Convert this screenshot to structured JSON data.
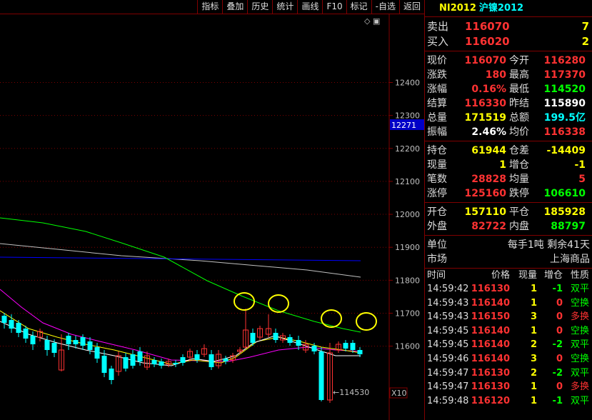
{
  "toolbar": {
    "items": [
      "指标",
      "叠加",
      "历史",
      "统计",
      "画线",
      "F10",
      "标记",
      "-自选",
      "返回"
    ]
  },
  "chart": {
    "price_labels": [
      "12400",
      "12300",
      "12271",
      "12200",
      "12100",
      "12000",
      "11900",
      "11800",
      "11700",
      "11600"
    ],
    "low_marker": "←114530",
    "zoom_label": "X10",
    "corner_symbols": "◇ ▣",
    "colors": {
      "up": "#ff3232",
      "down": "#00ffff",
      "ma5": "#ffffff",
      "ma10": "#ffff00",
      "ma20": "#ff00ff",
      "ma60": "#00ff00",
      "ma120": "#0000ff",
      "ma250": "#c0c0c0",
      "highlight": "#ffff00"
    }
  },
  "panel": {
    "code": "NI2012",
    "name": "沪镍2012",
    "orderbook": [
      {
        "label": "卖出",
        "price": "116070",
        "volume": "7"
      },
      {
        "label": "买入",
        "price": "116020",
        "volume": "2"
      }
    ],
    "quote1": [
      {
        "l1": "现价",
        "v1": "116070",
        "c1": "red",
        "l2": "今开",
        "v2": "116280",
        "c2": "red"
      },
      {
        "l1": "涨跌",
        "v1": "180",
        "c1": "red",
        "l2": "最高",
        "v2": "117370",
        "c2": "red"
      },
      {
        "l1": "涨幅",
        "v1": "0.16%",
        "c1": "red",
        "l2": "最低",
        "v2": "114520",
        "c2": "green"
      },
      {
        "l1": "结算",
        "v1": "116330",
        "c1": "red",
        "l2": "昨结",
        "v2": "115890",
        "c2": "white"
      },
      {
        "l1": "总量",
        "v1": "171519",
        "c1": "yellow",
        "l2": "总额",
        "v2": "199.5亿",
        "c2": "cyan"
      },
      {
        "l1": "振幅",
        "v1": "2.46%",
        "c1": "white",
        "l2": "均价",
        "v2": "116338",
        "c2": "red"
      }
    ],
    "quote2": [
      {
        "l1": "持仓",
        "v1": "61944",
        "c1": "yellow",
        "l2": "仓差",
        "v2": "-14409",
        "c2": "yellow"
      },
      {
        "l1": "现量",
        "v1": "1",
        "c1": "yellow",
        "l2": "增仓",
        "v2": "-1",
        "c2": "yellow"
      },
      {
        "l1": "笔数",
        "v1": "28828",
        "c1": "red",
        "l2": "均量",
        "v2": "5",
        "c2": "red"
      },
      {
        "l1": "涨停",
        "v1": "125160",
        "c1": "red",
        "l2": "跌停",
        "v2": "106610",
        "c2": "green"
      }
    ],
    "quote3": [
      {
        "l1": "开仓",
        "v1": "157110",
        "c1": "yellow",
        "l2": "平仓",
        "v2": "185928",
        "c2": "yellow"
      },
      {
        "l1": "外盘",
        "v1": "82722",
        "c1": "red",
        "l2": "内盘",
        "v2": "88797",
        "c2": "green"
      }
    ],
    "info": [
      {
        "label": "单位",
        "text": "每手1吨  剩余41天"
      },
      {
        "label": "市场",
        "text": "上海商品"
      }
    ],
    "trades_header": [
      "时间",
      "价格",
      "现量",
      "增仓",
      "性质"
    ],
    "trades": [
      {
        "time": "14:59:42",
        "price": "116130",
        "vol": "1",
        "oi": "-1",
        "type": "双平",
        "pc": "red",
        "oc": "green",
        "tc": "green"
      },
      {
        "time": "14:59:43",
        "price": "116140",
        "vol": "1",
        "oi": "0",
        "type": "空换",
        "pc": "red",
        "oc": "red",
        "tc": "green"
      },
      {
        "time": "14:59:43",
        "price": "116150",
        "vol": "3",
        "oi": "0",
        "type": "多换",
        "pc": "red",
        "oc": "red",
        "tc": "red"
      },
      {
        "time": "14:59:45",
        "price": "116140",
        "vol": "1",
        "oi": "0",
        "type": "空换",
        "pc": "red",
        "oc": "red",
        "tc": "green"
      },
      {
        "time": "14:59:45",
        "price": "116140",
        "vol": "2",
        "oi": "-2",
        "type": "双平",
        "pc": "red",
        "oc": "green",
        "tc": "green"
      },
      {
        "time": "14:59:46",
        "price": "116140",
        "vol": "3",
        "oi": "0",
        "type": "空换",
        "pc": "red",
        "oc": "red",
        "tc": "green"
      },
      {
        "time": "14:59:47",
        "price": "116130",
        "vol": "2",
        "oi": "-2",
        "type": "双平",
        "pc": "red",
        "oc": "green",
        "tc": "green"
      },
      {
        "time": "14:59:47",
        "price": "116130",
        "vol": "1",
        "oi": "0",
        "type": "多换",
        "pc": "red",
        "oc": "red",
        "tc": "red"
      },
      {
        "time": "14:59:48",
        "price": "116120",
        "vol": "1",
        "oi": "-1",
        "type": "双平",
        "pc": "red",
        "oc": "green",
        "tc": "green"
      }
    ]
  }
}
